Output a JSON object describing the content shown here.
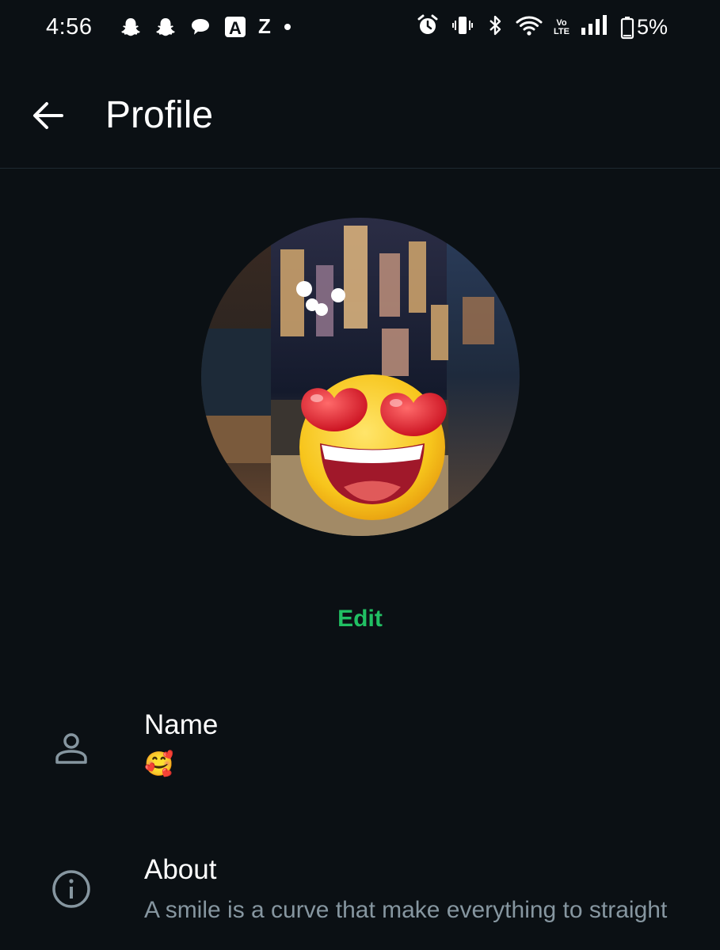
{
  "status_bar": {
    "time": "4:56",
    "left_icons": [
      "snapchat-icon",
      "snapchat-icon",
      "chat-bubble-icon",
      "a-app-icon",
      "z-app-icon",
      "dot-icon"
    ],
    "a_label": "A",
    "z_label": "Z",
    "right_icons": [
      "alarm-icon",
      "vibrate-icon",
      "bluetooth-icon",
      "wifi-icon",
      "volte-icon",
      "signal-icon",
      "battery-icon"
    ],
    "volte_top": "Vo",
    "volte_bottom": "LTE",
    "battery": "5%"
  },
  "header": {
    "title": "Profile"
  },
  "avatar": {
    "edit_label": "Edit"
  },
  "colors": {
    "background": "#0b1014",
    "accent": "#21c063",
    "secondary_text": "#8696a0"
  },
  "rows": [
    {
      "icon": "person-icon",
      "label": "Name",
      "value": "🥰"
    },
    {
      "icon": "info-icon",
      "label": "About",
      "value": "A smile is a curve that make everything to straight"
    }
  ]
}
